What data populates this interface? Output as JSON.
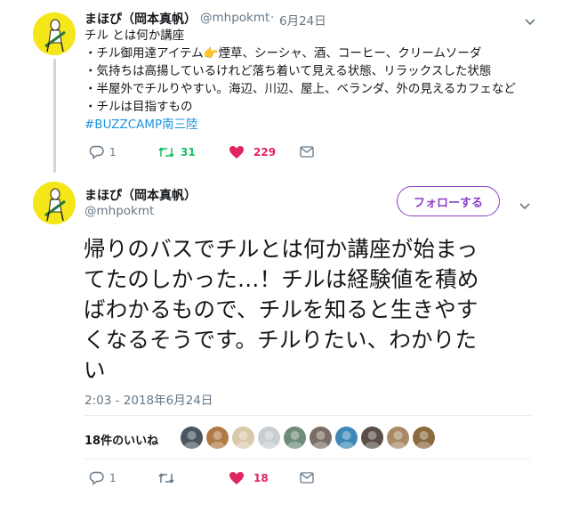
{
  "first_tweet": {
    "display_name": "まほぴ（岡本真帆）",
    "handle": "@mhpokmt",
    "separator": "·",
    "date": "6月24日",
    "lines": [
      "チル とは何か講座",
      "・チル御用達アイテム👉煙草、シーシャ、酒、コーヒー、クリームソーダ",
      "・気持ちは高揚しているけれど落ち着いて見える状態、リラックスした状態",
      "・半屋外でチルりやすい。海辺、川辺、屋上、ベランダ、外の見えるカフェなど",
      "・チルは目指すもの"
    ],
    "hashtag": "#BUZZCAMP南三陸",
    "replies": "1",
    "retweets": "31",
    "likes": "229"
  },
  "main_tweet": {
    "display_name": "まほぴ（岡本真帆）",
    "handle": "@mhpokmt",
    "follow_label": "フォローする",
    "text_lines": [
      "帰りのバスでチルとは何か講座が始まっ",
      "てたのしかった…！チルは経験値を積め",
      "ばわかるもので、チルを知ると生きやす",
      "くなるそうです。チルりたい、わかりた",
      "い"
    ],
    "timestamp": "2:03 - 2018年6月24日",
    "likes_summary": "18件のいいね",
    "replies": "1",
    "retweets": "",
    "likes": "18"
  },
  "icons": {
    "reply": "reply-icon",
    "retweet": "retweet-icon",
    "like": "heart-icon",
    "message": "envelope-icon",
    "chevron": "chevron-down-icon"
  },
  "colors": {
    "accent": "#8b3fc8",
    "retweet": "#17bf63",
    "like": "#e0245e",
    "hashtag": "#1b95e0",
    "muted": "#657786",
    "avatar_bg": "#f5e61a"
  },
  "liker_colors": [
    "#4a5560",
    "#b07a45",
    "#d9c9a8",
    "#c7cdd3",
    "#6d8c7a",
    "#7a6f68",
    "#3e88b8",
    "#5a4e46",
    "#a88a66",
    "#8a6a3e"
  ]
}
